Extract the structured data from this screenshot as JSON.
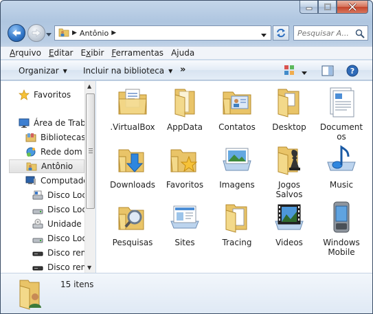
{
  "window": {
    "caption_buttons": [
      "minimize",
      "maximize",
      "close"
    ]
  },
  "address_bar": {
    "path": [
      "Antônio"
    ]
  },
  "search": {
    "placeholder": "Pesquisar A..."
  },
  "menu": {
    "items": [
      {
        "label": "Arquivo",
        "accel": "A",
        "rest": "rquivo"
      },
      {
        "label": "Editar",
        "accel": "E",
        "rest": "ditar"
      },
      {
        "label": "Exibir",
        "accel": "x",
        "pre": "E",
        "rest": "ibir"
      },
      {
        "label": "Ferramentas",
        "accel": "F",
        "rest": "erramentas"
      },
      {
        "label": "Ajuda",
        "accel": "j",
        "pre": "A",
        "rest": "uda"
      }
    ]
  },
  "toolbar": {
    "organize": "Organizar",
    "include_library": "Incluir na biblioteca",
    "more": "»"
  },
  "navpane": {
    "items": [
      {
        "label": "Favoritos",
        "icon": "star-icon"
      },
      {
        "label": "Área de Traba",
        "icon": "desktop-icon"
      },
      {
        "label": "Bibliotecas",
        "icon": "libraries-icon"
      },
      {
        "label": "Rede dom",
        "icon": "network-icon",
        "display": "Rede dom"
      },
      {
        "label": "Antônio",
        "icon": "user-folder-icon"
      },
      {
        "label": "Computado",
        "icon": "computer-icon"
      },
      {
        "label": "Disco Loc",
        "icon": "drive-icon"
      },
      {
        "label": "Disco Loc",
        "icon": "drive-icon"
      },
      {
        "label": "Unidade d",
        "icon": "cd-drive-icon"
      },
      {
        "label": "Disco Loc",
        "icon": "drive-icon"
      },
      {
        "label": "Disco rem",
        "icon": "removable-drive-icon"
      },
      {
        "label": "Disco rem",
        "icon": "removable-drive-icon"
      }
    ]
  },
  "files": [
    {
      "name": ".VirtualBox",
      "icon": "folder-document-icon"
    },
    {
      "name": "AppData",
      "icon": "folder-icon"
    },
    {
      "name": "Contatos",
      "icon": "contacts-folder-icon"
    },
    {
      "name": "Desktop",
      "icon": "desktop-folder-icon"
    },
    {
      "name": "Documentos",
      "icon": "documents-icon",
      "line1": "Document",
      "line2": "os"
    },
    {
      "name": "Downloads",
      "icon": "downloads-folder-icon"
    },
    {
      "name": "Favoritos",
      "icon": "favorites-folder-icon"
    },
    {
      "name": "Imagens",
      "icon": "pictures-icon"
    },
    {
      "name": "Jogos Salvos",
      "icon": "saved-games-icon",
      "line1": "Jogos",
      "line2": "Salvos"
    },
    {
      "name": "Music",
      "icon": "music-icon"
    },
    {
      "name": "Pesquisas",
      "icon": "searches-folder-icon"
    },
    {
      "name": "Sites",
      "icon": "sites-icon"
    },
    {
      "name": "Tracing",
      "icon": "folder-file-icon"
    },
    {
      "name": "Videos",
      "icon": "videos-icon"
    },
    {
      "name": "Windows Mobile",
      "icon": "mobile-device-icon",
      "line1": "Windows",
      "line2": "Mobile"
    }
  ],
  "details": {
    "count": "15 itens"
  }
}
